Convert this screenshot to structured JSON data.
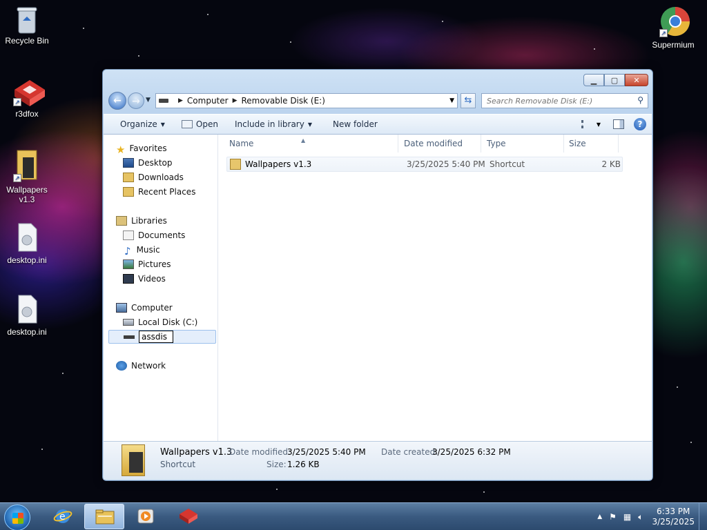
{
  "desktop": {
    "icons": [
      {
        "label": "Recycle Bin",
        "icon": "recycle-bin-icon"
      },
      {
        "label": "r3dfox",
        "icon": "r3dfox-icon"
      },
      {
        "label": "Wallpapers v1.3",
        "icon": "folder-shortcut-icon"
      },
      {
        "label": "desktop.ini",
        "icon": "settings-file-icon"
      },
      {
        "label": "desktop.ini",
        "icon": "settings-file-icon"
      },
      {
        "label": "Supermium",
        "icon": "supermium-icon"
      }
    ]
  },
  "window": {
    "address": {
      "crumbs": [
        "Computer",
        "Removable Disk (E:)"
      ]
    },
    "search_placeholder": "Search Removable Disk (E:)",
    "toolbar": {
      "organize": "Organize",
      "open": "Open",
      "include": "Include in library",
      "new_folder": "New folder"
    },
    "nav": {
      "favorites": "Favorites",
      "desktop": "Desktop",
      "downloads": "Downloads",
      "recent": "Recent Places",
      "libraries": "Libraries",
      "documents": "Documents",
      "music": "Music",
      "pictures": "Pictures",
      "videos": "Videos",
      "computer": "Computer",
      "local_disk": "Local Disk (C:)",
      "rename_value": "assdis",
      "network": "Network"
    },
    "columns": {
      "name": "Name",
      "date": "Date modified",
      "type": "Type",
      "size": "Size"
    },
    "files": [
      {
        "name": "Wallpapers v1.3",
        "date": "3/25/2025 5:40 PM",
        "type": "Shortcut",
        "size": "2 KB"
      }
    ],
    "details": {
      "name": "Wallpapers v1.3",
      "kind": "Shortcut",
      "date_modified_label": "Date modified:",
      "date_modified": "3/25/2025 5:40 PM",
      "size_label": "Size:",
      "size": "1.26 KB",
      "date_created_label": "Date created:",
      "date_created": "3/25/2025 6:32 PM"
    }
  },
  "taskbar": {
    "time": "6:33 PM",
    "date": "3/25/2025"
  },
  "colors": {
    "accent": "#2f6cc3",
    "taskbar": "#3a5a80",
    "close": "#c7452c"
  }
}
